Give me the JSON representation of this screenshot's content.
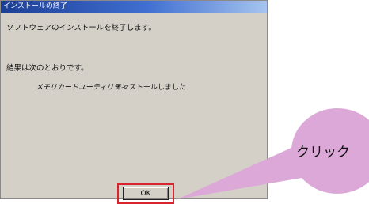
{
  "dialog": {
    "title": "インストールの終了",
    "message": "ソフトウェアのインストールを終了します。",
    "results_heading": "結果は次のとおりです。",
    "result_item_name": "メモリカードユーティリティ",
    "result_item_status": "インストールしました",
    "ok_label": "OK"
  },
  "callout": {
    "label": "クリック",
    "color": "#dca8d8",
    "highlight_color": "#d9232d"
  }
}
